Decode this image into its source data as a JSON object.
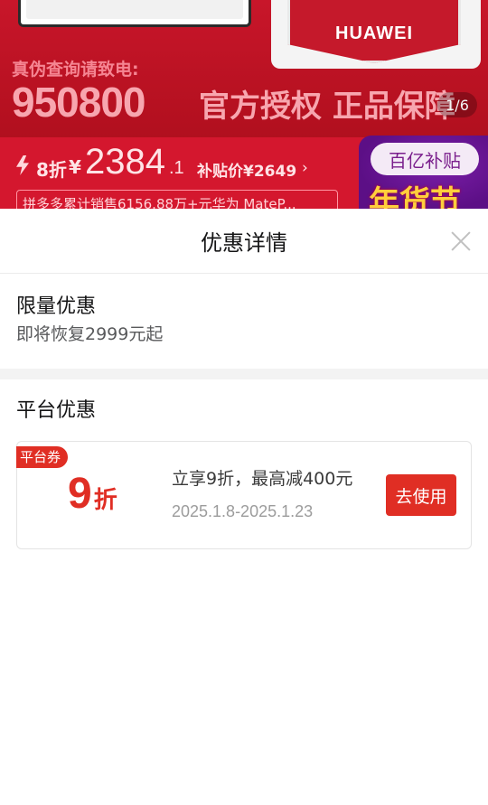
{
  "banner": {
    "brand": "HUAWEI",
    "hotline_label": "真伪查询请致电:",
    "hotline_number": "950800",
    "authorized_text": "官方授权 正品保障",
    "page_indicator": "1/6",
    "discount_tag": "8折",
    "currency": "¥",
    "price_integer": "2384",
    "price_decimal": ".1",
    "subsidy_price": "补贴价¥2649",
    "subsidy_chevron": "›",
    "promo_badge_top": "百亿补贴",
    "promo_badge_main": "年货节",
    "sales_text": "拼多多累计销售6156.88万+元华为 MateP..."
  },
  "sheet": {
    "title": "优惠详情",
    "limited": {
      "title": "限量优惠",
      "description": "即将恢复2999元起"
    },
    "platform": {
      "title": "平台优惠",
      "coupon": {
        "tag": "平台券",
        "value": "9",
        "unit": "折",
        "description": "立享9折，最高减400元",
        "validity": "2025.1.8-2025.1.23",
        "button_label": "去使用"
      }
    }
  },
  "colors": {
    "accent_red": "#e02e24",
    "banner_red": "#c8162a",
    "text_primary": "#151516",
    "text_secondary": "#58595b",
    "text_muted": "#9c9c9c"
  },
  "icons": {
    "close": "close-icon",
    "bolt": "bolt-icon",
    "chevron": "chevron-right-icon"
  }
}
